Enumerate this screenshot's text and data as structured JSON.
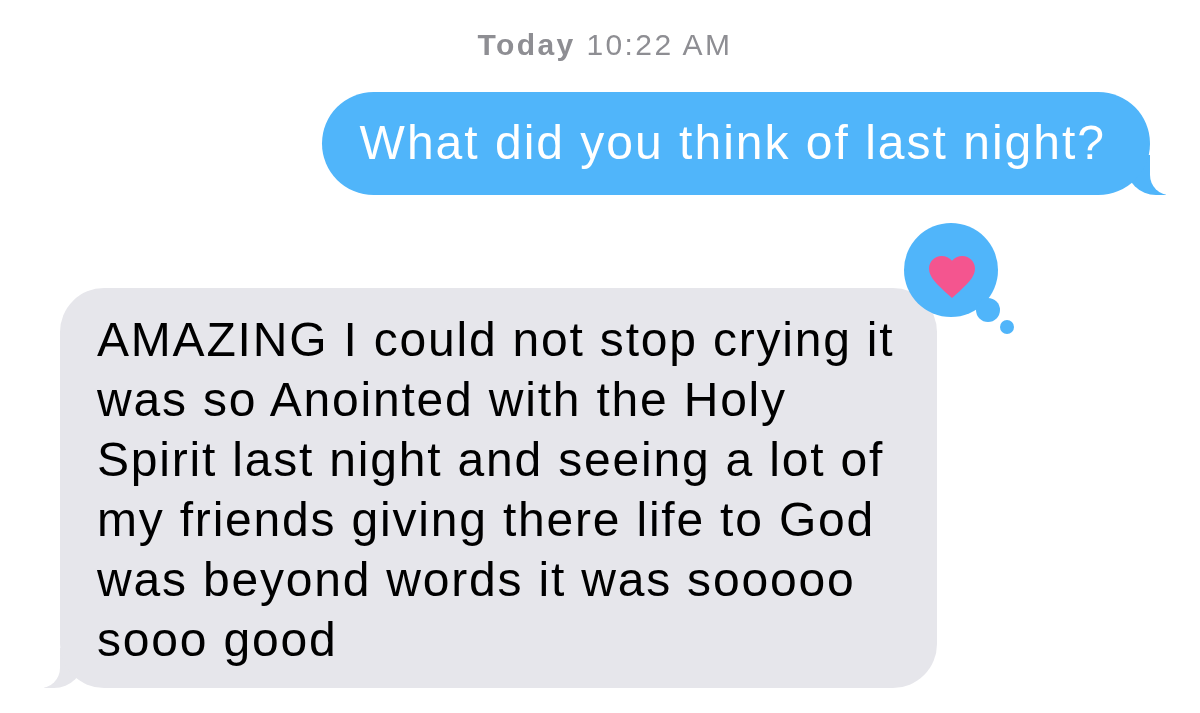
{
  "timestamp": "**Today** 10:22 AM",
  "messages": [
    {
      "kind": "sent",
      "text": "What did you think of last night?"
    },
    {
      "kind": "received",
      "text": "AMAZING I could not stop crying it was so Anointed with the Holy Spirit last night and seeing a lot of my friends giving there life to God was beyond words it was sooooo sooo good",
      "loved": true
    }
  ]
}
